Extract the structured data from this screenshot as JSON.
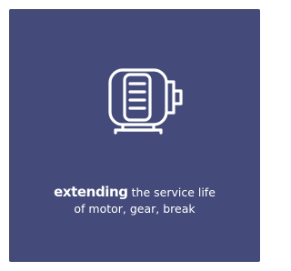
{
  "card": {
    "background": "#444b7a",
    "icon": "electric-motor-icon",
    "caption": {
      "emphasis": "extending",
      "rest": " the service life",
      "line2": "of motor, gear, break"
    }
  }
}
